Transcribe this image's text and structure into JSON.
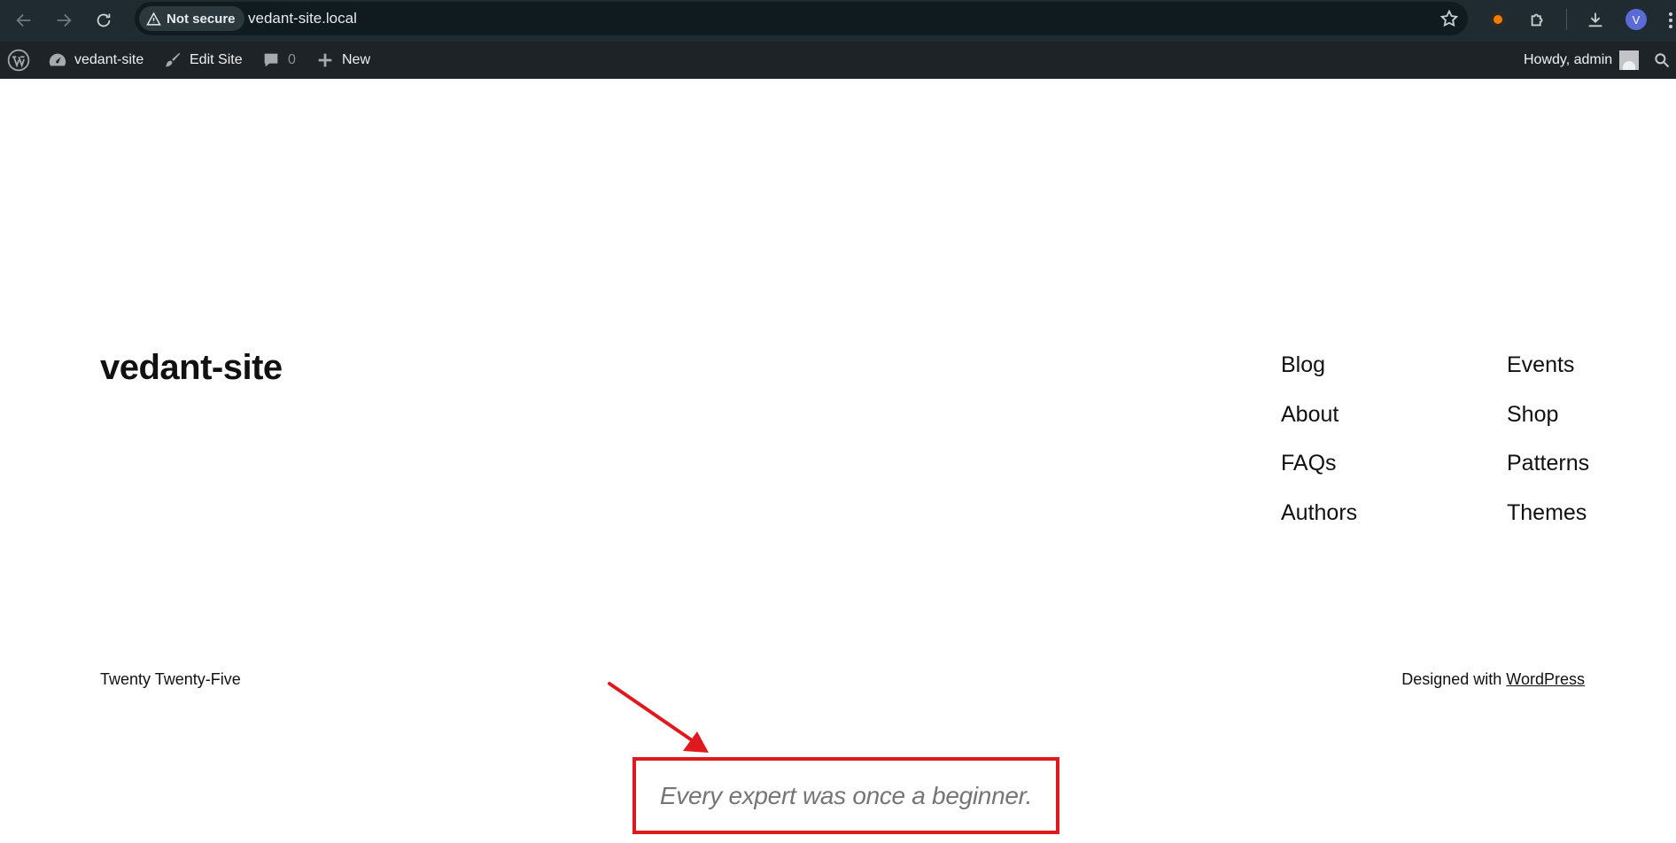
{
  "browser": {
    "security_label": "Not secure",
    "url": "vedant-site.local",
    "profile_initial": "V"
  },
  "admin_bar": {
    "site_name": "vedant-site",
    "edit_site": "Edit Site",
    "comments_count": "0",
    "new_label": "New",
    "greeting": "Howdy, admin"
  },
  "site": {
    "title": "vedant-site",
    "nav_col1": [
      "Blog",
      "About",
      "FAQs",
      "Authors"
    ],
    "nav_col2": [
      "Events",
      "Shop",
      "Patterns",
      "Themes"
    ]
  },
  "footer": {
    "theme_name": "Twenty Twenty-Five",
    "designed_prefix": "Designed with ",
    "designed_link": "WordPress"
  },
  "annotation": {
    "quote": "Every expert was once a beginner.",
    "highlight_color": "#e0191e"
  }
}
